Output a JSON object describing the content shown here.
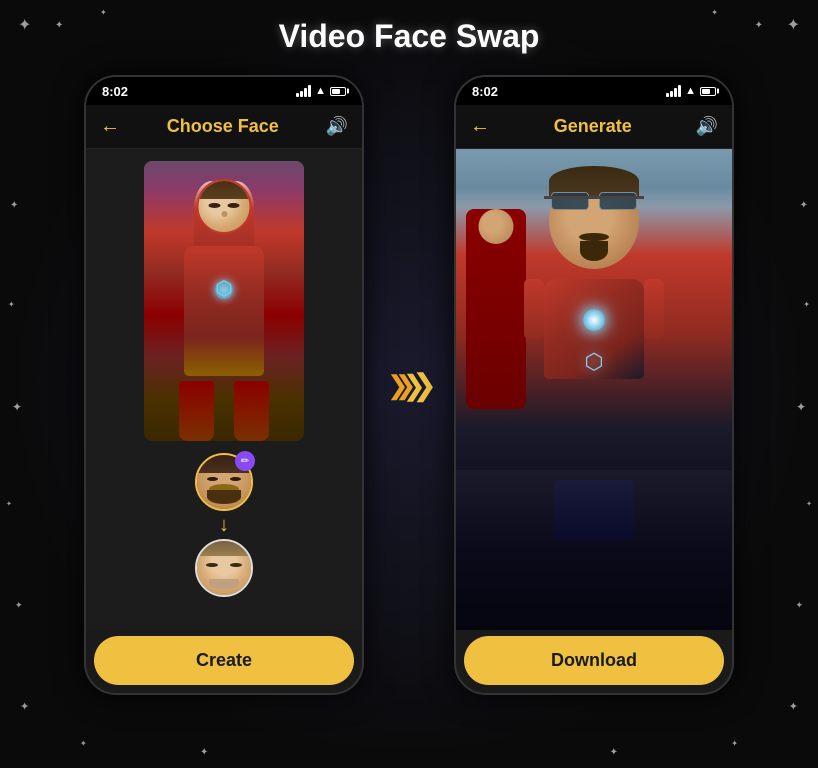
{
  "page": {
    "title": "Video Face Swap",
    "background_color": "#0a0a0a"
  },
  "left_phone": {
    "status_time": "8:02",
    "header_title": "Choose Face",
    "back_label": "←",
    "sound_label": "🔊",
    "create_button": "Create"
  },
  "right_phone": {
    "status_time": "8:02",
    "header_title": "Generate",
    "back_label": "←",
    "sound_label": "🔊",
    "download_button": "Download"
  },
  "arrows": {
    "between": "❯❯❯",
    "down": "↓"
  },
  "icons": {
    "pencil": "✏",
    "back_arrow": "←",
    "sound": "🔊",
    "chevron_right": "❯"
  }
}
